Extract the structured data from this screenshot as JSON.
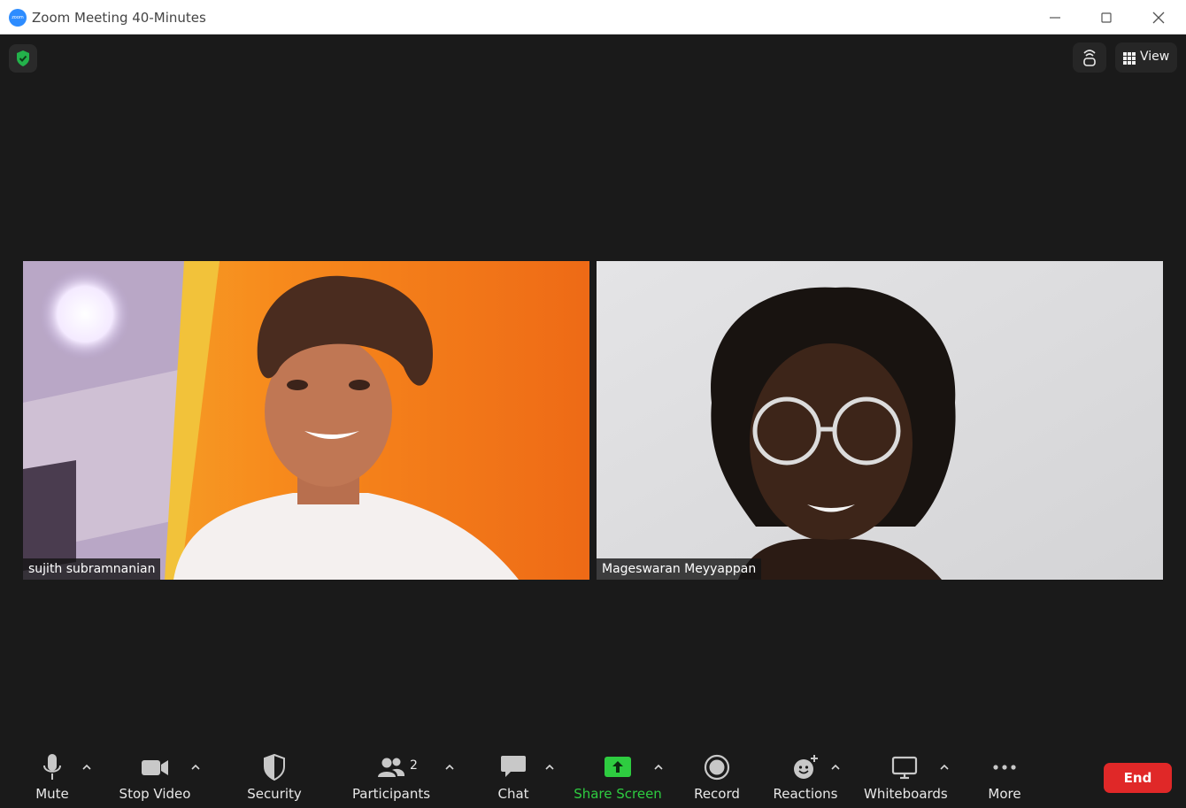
{
  "window": {
    "app_logo_text": "zoom",
    "title": "Zoom Meeting 40-Minutes"
  },
  "header": {
    "view_label": "View"
  },
  "participants": [
    {
      "name": "sujith subramnanian"
    },
    {
      "name": "Mageswaran Meyyappan"
    }
  ],
  "toolbar": {
    "mute": "Mute",
    "stop_video": "Stop Video",
    "security": "Security",
    "participants": "Participants",
    "participants_count": "2",
    "chat": "Chat",
    "share_screen": "Share Screen",
    "record": "Record",
    "reactions": "Reactions",
    "whiteboards": "Whiteboards",
    "more": "More",
    "end": "End"
  },
  "colors": {
    "background": "#1a1a1a",
    "share_green": "#2ecc40",
    "end_red": "#e02828",
    "shield_green": "#23b24b",
    "brand_blue": "#2d8cff"
  }
}
